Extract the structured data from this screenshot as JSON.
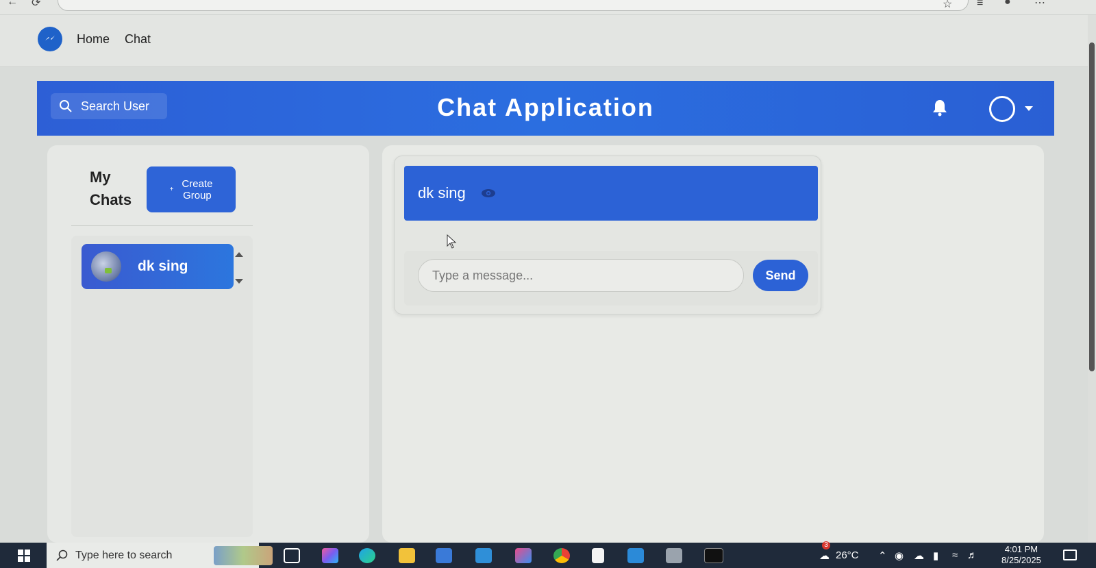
{
  "nav": {
    "home": "Home",
    "chat": "Chat"
  },
  "header": {
    "search_label": "Search User",
    "title": "Chat Application"
  },
  "sidebar": {
    "title_line1": "My",
    "title_line2": "Chats",
    "create_line1": "Create",
    "create_line2": "Group",
    "chats": [
      {
        "name": "dk sing",
        "selected": true
      }
    ]
  },
  "chat": {
    "title": "dk sing",
    "input_placeholder": "Type a message...",
    "send_label": "Send"
  },
  "taskbar": {
    "search_placeholder": "Type here to search",
    "weather": "26°C",
    "time": "4:01 PM",
    "date": "8/25/2025",
    "weather_badge": "3"
  },
  "colors": {
    "primary": "#2c62d6",
    "header_blue": "#2b6ee0",
    "panel_bg": "#e6e8e5",
    "taskbar": "#1f2a3a"
  }
}
